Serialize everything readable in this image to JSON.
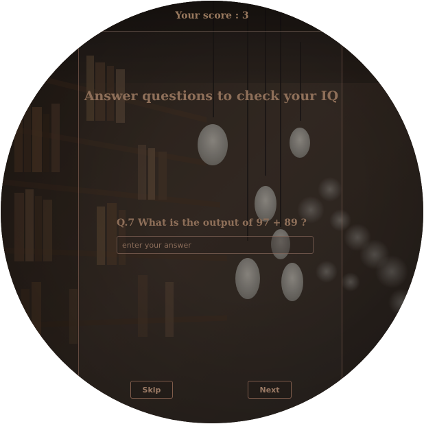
{
  "score": {
    "text": "Your score : 3"
  },
  "heading": {
    "text": "Answer questions to check your IQ"
  },
  "question": {
    "text": "Q.7 What is the output of 97 + 89 ?"
  },
  "answer": {
    "placeholder": "enter your answer",
    "value": ""
  },
  "buttons": {
    "skip": "Skip",
    "next": "Next"
  },
  "colors": {
    "accent_text": "#8e6f59",
    "button_border": "#a07360",
    "background_dark": "#1f1814"
  }
}
